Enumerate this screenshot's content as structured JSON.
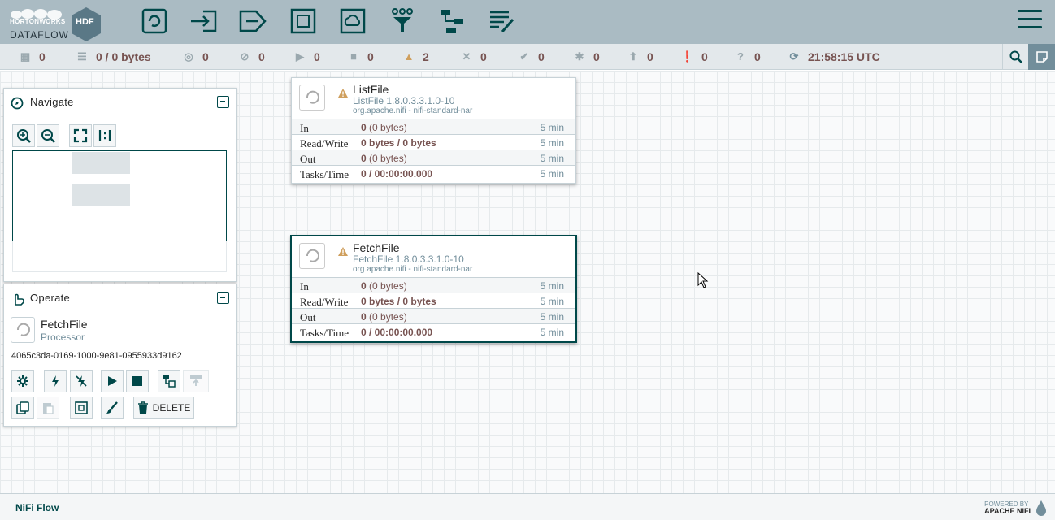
{
  "logo": {
    "brand": "HORTONWORKS",
    "product": "DATAFLOW",
    "badge": "HDF"
  },
  "toolbar": {
    "items": [
      {
        "name": "processor-icon"
      },
      {
        "name": "input-port-icon"
      },
      {
        "name": "output-port-icon"
      },
      {
        "name": "process-group-icon"
      },
      {
        "name": "remote-process-group-icon"
      },
      {
        "name": "funnel-icon"
      },
      {
        "name": "template-icon"
      },
      {
        "name": "label-icon"
      }
    ]
  },
  "status": {
    "active_threads": "0",
    "queued": "0 / 0 bytes",
    "transmitting": "0",
    "not_transmitting": "0",
    "running": "0",
    "stopped": "0",
    "invalid": "2",
    "disabled": "0",
    "up_to_date": "0",
    "locally_modified": "0",
    "stale": "0",
    "locally_modified_stale": "0",
    "sync_failure": "0",
    "refresh_time": "21:58:15 UTC"
  },
  "navigate": {
    "title": "Navigate"
  },
  "operate": {
    "title": "Operate",
    "selected_name": "FetchFile",
    "selected_type": "Processor",
    "selected_id": "4065c3da-0169-1000-9e81-0955933d9162",
    "delete_label": "DELETE"
  },
  "processors": [
    {
      "name": "ListFile",
      "type": "ListFile 1.8.0.3.3.1.0-10",
      "bundle": "org.apache.nifi - nifi-standard-nar",
      "rows": [
        {
          "label": "In",
          "value": "0",
          "extra": " (0 bytes)",
          "time": "5 min"
        },
        {
          "label": "Read/Write",
          "value": "0 bytes / 0 bytes",
          "extra": "",
          "time": "5 min"
        },
        {
          "label": "Out",
          "value": "0",
          "extra": " (0 bytes)",
          "time": "5 min"
        },
        {
          "label": "Tasks/Time",
          "value": "0 / 00:00:00.000",
          "extra": "",
          "time": "5 min"
        }
      ]
    },
    {
      "name": "FetchFile",
      "type": "FetchFile 1.8.0.3.3.1.0-10",
      "bundle": "org.apache.nifi - nifi-standard-nar",
      "rows": [
        {
          "label": "In",
          "value": "0",
          "extra": " (0 bytes)",
          "time": "5 min"
        },
        {
          "label": "Read/Write",
          "value": "0 bytes / 0 bytes",
          "extra": "",
          "time": "5 min"
        },
        {
          "label": "Out",
          "value": "0",
          "extra": " (0 bytes)",
          "time": "5 min"
        },
        {
          "label": "Tasks/Time",
          "value": "0 / 00:00:00.000",
          "extra": "",
          "time": "5 min"
        }
      ]
    }
  ],
  "footer": {
    "breadcrumb": "NiFi Flow",
    "powered_by": "POWERED BY",
    "apache_nifi": "APACHE NIFI"
  },
  "colors": {
    "header": "#aabbc3",
    "accent": "#004849",
    "value": "#775351",
    "muted": "#728e9b",
    "warning": "#cf9f5d"
  }
}
